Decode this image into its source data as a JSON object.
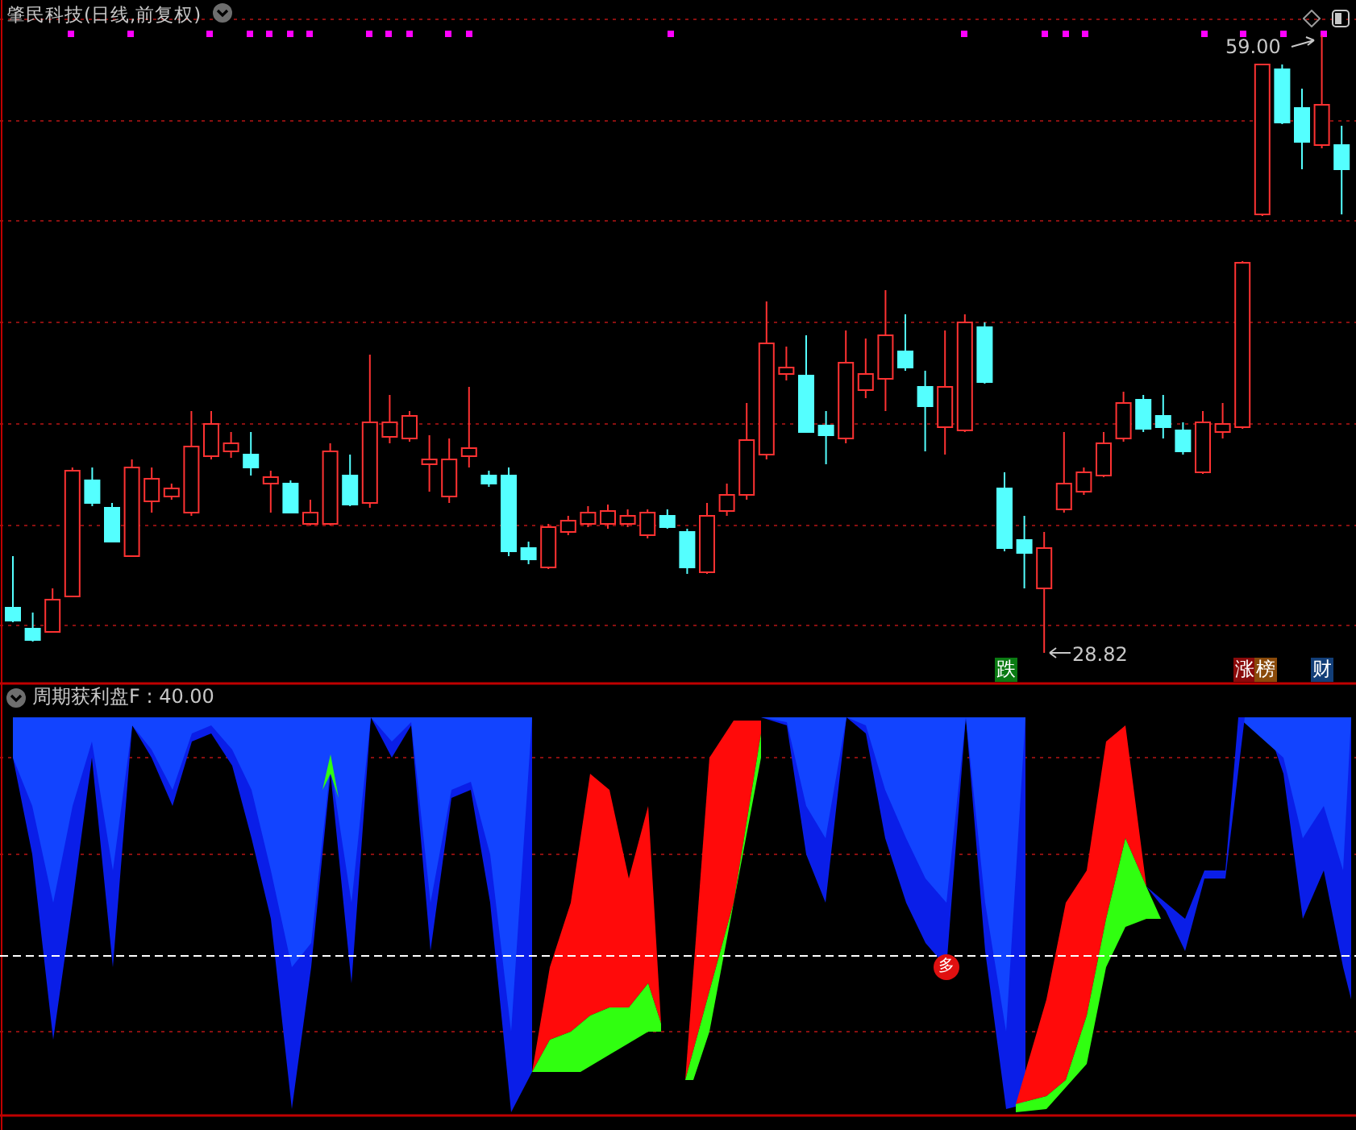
{
  "header": {
    "title": "肇民科技(日线,前复权)"
  },
  "price_labels": {
    "high": "59.00",
    "low": "28.82"
  },
  "tags": [
    {
      "text": "跌",
      "color": "#0a7a12"
    },
    {
      "text": "涨",
      "color": "#8a0a0a"
    },
    {
      "text": "榜",
      "color": "#8a4a0a"
    },
    {
      "text": "财",
      "color": "#123e78"
    }
  ],
  "indicator": {
    "name": "周期获利盘F :",
    "value": "40.00",
    "signal": "多"
  }
}
